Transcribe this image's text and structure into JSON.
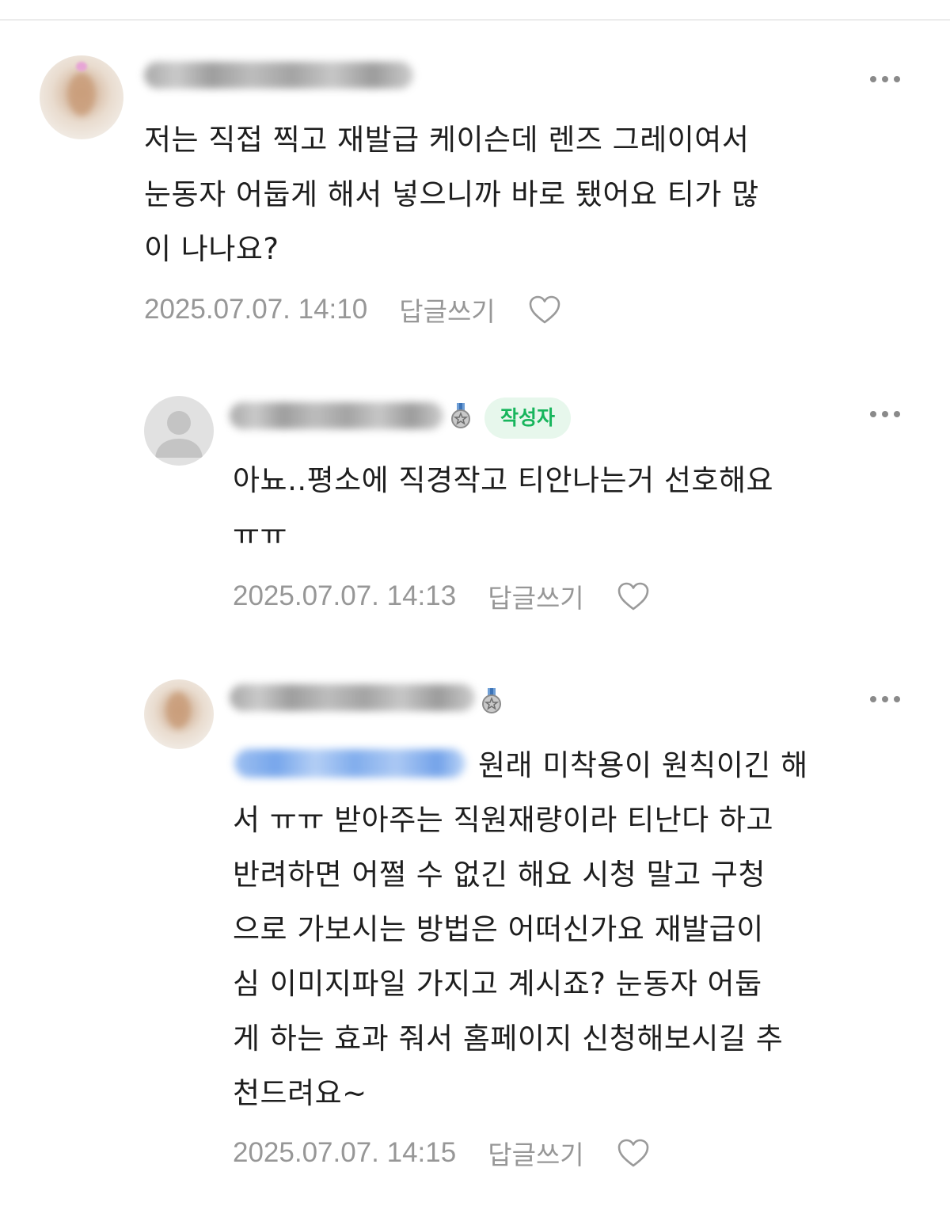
{
  "comments": [
    {
      "avatar": "user-photo-blurred",
      "nickname_hidden": true,
      "is_author": false,
      "text_lines": [
        "저는 직접 찍고 재발급 케이슨데 렌즈 그레이여서",
        "눈동자 어둡게 해서 넣으니까 바로 됐어요 티가 많",
        "이 나나요?"
      ],
      "date": "2025.07.07. 14:10",
      "reply_label": "답글쓰기"
    },
    {
      "avatar": "default-user-icon",
      "nickname_hidden": true,
      "is_author": true,
      "author_badge": "작성자",
      "text_lines": [
        "아뇨..평소에 직경작고 티안나는거 선호해요",
        "ㅠㅠ"
      ],
      "date": "2025.07.07. 14:13",
      "reply_label": "답글쓰기"
    },
    {
      "avatar": "user-photo-blurred",
      "nickname_hidden": true,
      "is_author": false,
      "mention_hidden": true,
      "text_lines": [
        "원래 미착용이 원칙이긴 해",
        "서 ㅠㅠ 받아주는 직원재량이라 티난다 하고",
        "반려하면 어쩔 수 없긴 해요 시청 말고 구청",
        "으로 가보시는 방법은 어떠신가요 재발급이",
        "심 이미지파일 가지고 계시죠? 눈동자 어둡",
        "게 하는 효과 줘서 홈페이지 신청해보시길 추",
        "천드려요~"
      ],
      "date": "2025.07.07. 14:15",
      "reply_label": "답글쓰기"
    }
  ],
  "icons": {
    "more": "more-dots-icon",
    "like": "heart-outline-icon",
    "medal": "medal-icon"
  },
  "colors": {
    "author_badge_bg": "#e7f7ec",
    "author_badge_text": "#17b55c",
    "meta_text": "#979797",
    "mention_blue": "#5f97e8"
  }
}
